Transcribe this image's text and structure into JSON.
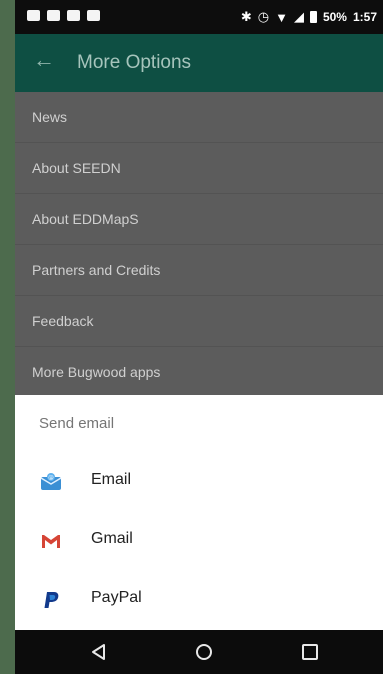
{
  "status_bar": {
    "battery_text": "50%",
    "time": "1:57"
  },
  "app_bar": {
    "title": "More Options"
  },
  "menu": {
    "items": [
      {
        "label": "News"
      },
      {
        "label": "About SEEDN"
      },
      {
        "label": "About EDDMapS"
      },
      {
        "label": "Partners and Credits"
      },
      {
        "label": "Feedback"
      },
      {
        "label": "More Bugwood apps"
      }
    ]
  },
  "share_sheet": {
    "title": "Send email",
    "options": [
      {
        "label": "Email",
        "icon": "email-app-icon"
      },
      {
        "label": "Gmail",
        "icon": "gmail-icon"
      },
      {
        "label": "PayPal",
        "icon": "paypal-icon"
      }
    ]
  },
  "nav_bar": {
    "buttons": [
      "back-nav-icon",
      "home-nav-icon",
      "recents-nav-icon"
    ]
  },
  "colors": {
    "app_bar": "#0e4f43",
    "scrim_list": "#5c5c5c",
    "sheet": "#ffffff"
  }
}
